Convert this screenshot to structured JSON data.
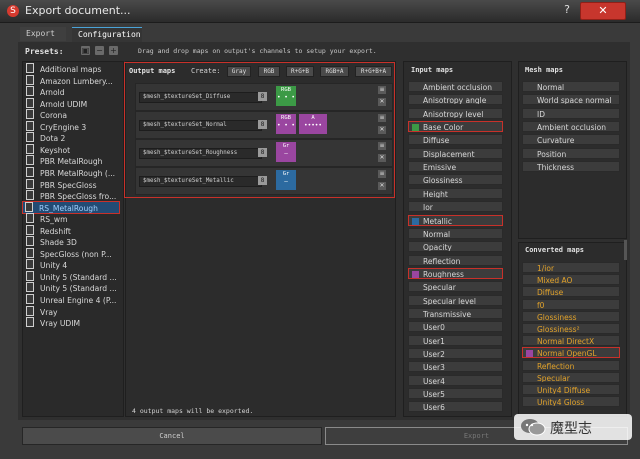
{
  "window": {
    "title": "Export document...",
    "help_label": "?",
    "close_label": "✕"
  },
  "tabs": [
    {
      "label": "Export"
    },
    {
      "label": "Configuration"
    }
  ],
  "presets": {
    "header": "Presets:",
    "items": [
      "Additional maps",
      "Amazon Lumbery...",
      "Arnold",
      "Arnold UDIM",
      "Corona",
      "CryEngine 3",
      "Dota 2",
      "Keyshot",
      "PBR MetalRough",
      "PBR MetalRough (...",
      "PBR SpecGloss",
      "PBR SpecGloss fro...",
      "RS_MetalRough",
      "RS_wm",
      "Redshift",
      "Shade 3D",
      "SpecGloss (non P...",
      "Unity 4",
      "Unity 5 (Standard ...",
      "Unity 5 (Standard ...",
      "Unreal Engine 4 (P...",
      "Vray",
      "Vray UDIM"
    ],
    "selected": "RS_MetalRough"
  },
  "hint": "Drag and drop maps on output's channels to setup your export.",
  "output_maps": {
    "header": "Output maps",
    "create_label": "Create:",
    "create_buttons": [
      "Gray",
      "RGB",
      "R+G+B",
      "RGB+A",
      "R+G+B+A"
    ],
    "rows": [
      {
        "name": "$mesh_$textureSet_Diffuse",
        "format": "8",
        "channels": [
          {
            "label": "RGB",
            "color": "#3c9a46"
          }
        ]
      },
      {
        "name": "$mesh_$textureSet_Normal",
        "format": "8",
        "channels": [
          {
            "label": "RGB",
            "color": "#9a46a0"
          },
          {
            "label": "A",
            "color": "#9a46a0"
          }
        ]
      },
      {
        "name": "$mesh_$textureSet_Roughness",
        "format": "8",
        "channels": [
          {
            "label": "Gr",
            "color": "#9a46a0"
          }
        ]
      },
      {
        "name": "$mesh_$textureSet_Metallic",
        "format": "8",
        "channels": [
          {
            "label": "Gr",
            "color": "#2c6aa0"
          }
        ]
      }
    ],
    "footer": "4 output maps will be exported."
  },
  "input_maps": {
    "header": "Input maps",
    "items": [
      {
        "label": "Ambient occlusion"
      },
      {
        "label": "Anisotropy angle"
      },
      {
        "label": "Anisotropy level"
      },
      {
        "label": "Base Color",
        "swatch": "#3c9a46",
        "highlight": true
      },
      {
        "label": "Diffuse"
      },
      {
        "label": "Displacement"
      },
      {
        "label": "Emissive"
      },
      {
        "label": "Glossiness"
      },
      {
        "label": "Height"
      },
      {
        "label": "Ior"
      },
      {
        "label": "Metallic",
        "swatch": "#2c6aa0",
        "highlight": true
      },
      {
        "label": "Normal"
      },
      {
        "label": "Opacity"
      },
      {
        "label": "Reflection"
      },
      {
        "label": "Roughness",
        "swatch": "#9a46a0",
        "highlight": true
      },
      {
        "label": "Specular"
      },
      {
        "label": "Specular level"
      },
      {
        "label": "Transmissive"
      },
      {
        "label": "User0"
      },
      {
        "label": "User1"
      },
      {
        "label": "User2"
      },
      {
        "label": "User3"
      },
      {
        "label": "User4"
      },
      {
        "label": "User5"
      },
      {
        "label": "User6"
      }
    ]
  },
  "mesh_maps": {
    "header": "Mesh maps",
    "items": [
      "Normal",
      "World space normal",
      "ID",
      "Ambient occlusion",
      "Curvature",
      "Position",
      "Thickness"
    ]
  },
  "converted_maps": {
    "header": "Converted maps",
    "items": [
      {
        "label": "1/ior"
      },
      {
        "label": "Mixed AO"
      },
      {
        "label": "Diffuse"
      },
      {
        "label": "f0"
      },
      {
        "label": "Glossiness"
      },
      {
        "label": "Glossiness²"
      },
      {
        "label": "Normal DirectX"
      },
      {
        "label": "Normal OpenGL",
        "swatch": "#9a46a0",
        "highlight": true
      },
      {
        "label": "Reflection"
      },
      {
        "label": "Specular"
      },
      {
        "label": "Unity4 Diffuse"
      },
      {
        "label": "Unity4 Gloss"
      }
    ]
  },
  "buttons": {
    "cancel": "Cancel",
    "export": "Export"
  },
  "watermark": {
    "text": "魔型志"
  },
  "colors": {
    "highlight_border": "#c8312a",
    "selection": "#224b74",
    "converted_text": "#e1a22a"
  }
}
